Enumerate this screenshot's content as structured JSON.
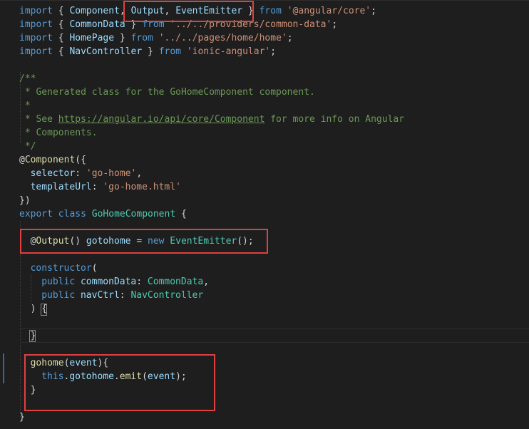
{
  "editor": {
    "lines": [
      [
        {
          "t": "import",
          "c": "kw"
        },
        {
          "t": " { ",
          "c": "pun"
        },
        {
          "t": "Component",
          "c": "var"
        },
        {
          "t": ", ",
          "c": "pun"
        },
        {
          "t": "Output",
          "c": "var"
        },
        {
          "t": ", ",
          "c": "pun"
        },
        {
          "t": "EventEmitter",
          "c": "var"
        },
        {
          "t": " } ",
          "c": "pun"
        },
        {
          "t": "from",
          "c": "kw"
        },
        {
          "t": " ",
          "c": "pun"
        },
        {
          "t": "'@angular/core'",
          "c": "str"
        },
        {
          "t": ";",
          "c": "pun"
        }
      ],
      [
        {
          "t": "import",
          "c": "kw"
        },
        {
          "t": " { ",
          "c": "pun"
        },
        {
          "t": "CommonData",
          "c": "var"
        },
        {
          "t": " } ",
          "c": "pun"
        },
        {
          "t": "from",
          "c": "kw"
        },
        {
          "t": " ",
          "c": "pun"
        },
        {
          "t": "'../../providers/common-data'",
          "c": "str"
        },
        {
          "t": ";",
          "c": "pun"
        }
      ],
      [
        {
          "t": "import",
          "c": "kw"
        },
        {
          "t": " { ",
          "c": "pun"
        },
        {
          "t": "HomePage",
          "c": "var"
        },
        {
          "t": " } ",
          "c": "pun"
        },
        {
          "t": "from",
          "c": "kw"
        },
        {
          "t": " ",
          "c": "pun"
        },
        {
          "t": "'../../pages/home/home'",
          "c": "str"
        },
        {
          "t": ";",
          "c": "pun"
        }
      ],
      [
        {
          "t": "import",
          "c": "kw"
        },
        {
          "t": " { ",
          "c": "pun"
        },
        {
          "t": "NavController",
          "c": "var"
        },
        {
          "t": " } ",
          "c": "pun"
        },
        {
          "t": "from",
          "c": "kw"
        },
        {
          "t": " ",
          "c": "pun"
        },
        {
          "t": "'ionic-angular'",
          "c": "str"
        },
        {
          "t": ";",
          "c": "pun"
        }
      ],
      [],
      [
        {
          "t": "/**",
          "c": "com"
        }
      ],
      [
        {
          "t": " * Generated class for the GoHomeComponent component.",
          "c": "com"
        }
      ],
      [
        {
          "t": " *",
          "c": "com"
        }
      ],
      [
        {
          "t": " * See ",
          "c": "com"
        },
        {
          "t": "https://angular.io/api/core/Component",
          "c": "link"
        },
        {
          "t": " for more info on Angular",
          "c": "com"
        }
      ],
      [
        {
          "t": " * Components.",
          "c": "com"
        }
      ],
      [
        {
          "t": " */",
          "c": "com"
        }
      ],
      [
        {
          "t": "@",
          "c": "pun"
        },
        {
          "t": "Component",
          "c": "fn"
        },
        {
          "t": "({",
          "c": "pun"
        }
      ],
      [
        {
          "i": 1
        },
        {
          "t": "selector",
          "c": "var"
        },
        {
          "t": ": ",
          "c": "pun"
        },
        {
          "t": "'go-home'",
          "c": "str"
        },
        {
          "t": ",",
          "c": "pun"
        }
      ],
      [
        {
          "i": 1
        },
        {
          "t": "templateUrl",
          "c": "var"
        },
        {
          "t": ": ",
          "c": "pun"
        },
        {
          "t": "'go-home.html'",
          "c": "str"
        }
      ],
      [
        {
          "t": "})",
          "c": "pun"
        }
      ],
      [
        {
          "t": "export",
          "c": "kw"
        },
        {
          "t": " ",
          "c": "pun"
        },
        {
          "t": "class",
          "c": "kw"
        },
        {
          "t": " ",
          "c": "pun"
        },
        {
          "t": "GoHomeComponent",
          "c": "type"
        },
        {
          "t": " {",
          "c": "pun"
        }
      ],
      [],
      [
        {
          "i": 1
        },
        {
          "t": "@",
          "c": "pun"
        },
        {
          "t": "Output",
          "c": "fn"
        },
        {
          "t": "() ",
          "c": "pun"
        },
        {
          "t": "gotohome",
          "c": "var"
        },
        {
          "t": " = ",
          "c": "pun"
        },
        {
          "t": "new",
          "c": "kw"
        },
        {
          "t": " ",
          "c": "pun"
        },
        {
          "t": "EventEmitter",
          "c": "type"
        },
        {
          "t": "();",
          "c": "pun"
        }
      ],
      [],
      [
        {
          "i": 1
        },
        {
          "t": "constructor",
          "c": "kw"
        },
        {
          "t": "(",
          "c": "pun"
        }
      ],
      [
        {
          "i": 2
        },
        {
          "t": "public",
          "c": "kw"
        },
        {
          "t": " ",
          "c": "pun"
        },
        {
          "t": "commonData",
          "c": "var"
        },
        {
          "t": ": ",
          "c": "pun"
        },
        {
          "t": "CommonData",
          "c": "type"
        },
        {
          "t": ",",
          "c": "pun"
        }
      ],
      [
        {
          "i": 2
        },
        {
          "t": "public",
          "c": "kw"
        },
        {
          "t": " ",
          "c": "pun"
        },
        {
          "t": "navCtrl",
          "c": "var"
        },
        {
          "t": ": ",
          "c": "pun"
        },
        {
          "t": "NavController",
          "c": "type"
        }
      ],
      [
        {
          "i": 1
        },
        {
          "t": ") {",
          "c": "pun"
        }
      ],
      [],
      [
        {
          "i": 1
        },
        {
          "t": "}",
          "c": "pun"
        }
      ],
      [],
      [
        {
          "i": 1
        },
        {
          "t": "gohome",
          "c": "fn"
        },
        {
          "t": "(",
          "c": "pun"
        },
        {
          "t": "event",
          "c": "var"
        },
        {
          "t": "){",
          "c": "pun"
        }
      ],
      [
        {
          "i": 2
        },
        {
          "t": "this",
          "c": "kw"
        },
        {
          "t": ".",
          "c": "pun"
        },
        {
          "t": "gotohome",
          "c": "var"
        },
        {
          "t": ".",
          "c": "pun"
        },
        {
          "t": "emit",
          "c": "fn"
        },
        {
          "t": "(",
          "c": "pun"
        },
        {
          "t": "event",
          "c": "var"
        },
        {
          "t": ");",
          "c": "pun"
        }
      ],
      [
        {
          "i": 1
        },
        {
          "t": "}",
          "c": "pun"
        }
      ],
      [],
      [
        {
          "t": "}",
          "c": "pun"
        }
      ]
    ]
  },
  "colors": {
    "background": "#1e1e1e",
    "highlight_box": "#e0403f",
    "keyword": "#569cd6",
    "type": "#4ec9b0",
    "variable": "#9cdcfe",
    "function": "#dcdcaa",
    "string": "#ce9178",
    "comment": "#6a9955"
  }
}
